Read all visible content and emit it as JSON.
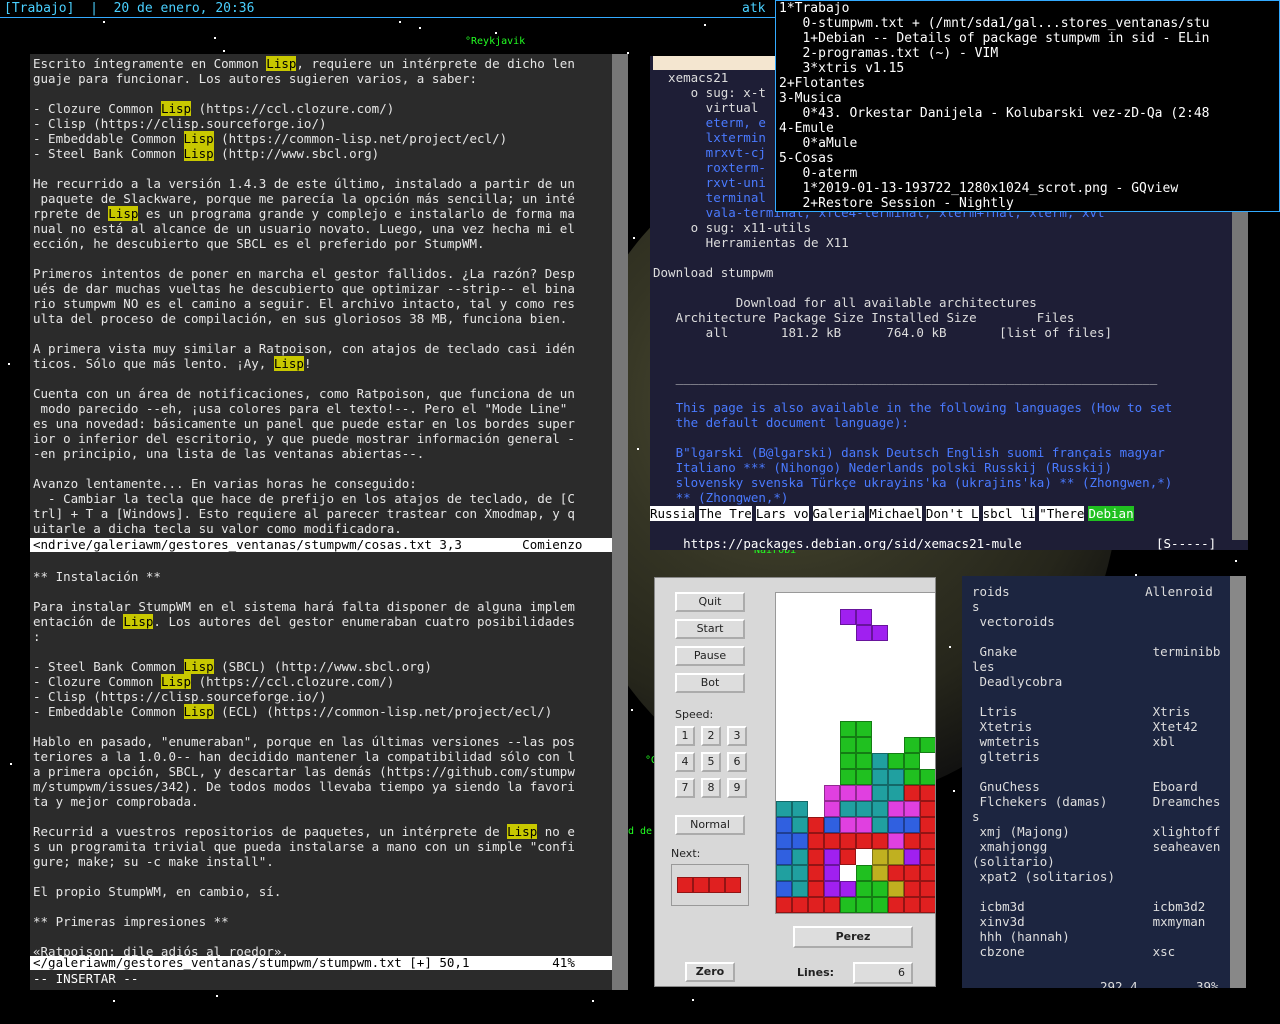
{
  "modeline": {
    "text": "[Trabajo]  |  20 de enero, 20:36",
    "right": "atk"
  },
  "cities": [
    "°Reykjavik",
    "°Nairobi",
    "°G",
    "d de"
  ],
  "menu": {
    "lines": [
      "1*Trabajo",
      "   0-stumpwm.txt + (/mnt/sda1/gal...stores_ventanas/stu",
      "   1+Debian -- Details of package stumpwm in sid - ELin",
      "   2-programas.txt (~) - VIM",
      "   3*xtris v1.15",
      "2+Flotantes",
      "3-Musica",
      "   0*43. Orkestar Danijela - Kolubarski vez-zD-Qa (2:48",
      "4-Emule",
      "   0*aMule",
      "5-Cosas",
      "   0-aterm",
      "   1*2019-01-13-193722_1280x1024_scrot.png - GQview",
      "   2+Restore Session - Nightly"
    ]
  },
  "vim": {
    "top_lines": [
      "Escrito íntegramente en Common |Lisp|, requiere un intérprete de dicho len",
      "guaje para funcionar. Los autores sugieren varios, a saber:",
      "",
      "- Clozure Common |Lisp| (https://ccl.clozure.com/)",
      "- Clisp (https://clisp.sourceforge.io/)",
      "- Embeddable Common |Lisp| (https://common-lisp.net/project/ecl/)",
      "- Steel Bank Common |Lisp| (http://www.sbcl.org)",
      "",
      "He recurrido a la versión 1.4.3 de este último, instalado a partir de un",
      " paquete de Slackware, porque me parecía la opción más sencilla; un inté",
      "rprete de |Lisp| es un programa grande y complejo e instalarlo de forma ma",
      "nual no está al alcance de un usuario novato. Luego, una vez hecha mi el",
      "ección, he descubierto que SBCL es el preferido por StumpWM.",
      "",
      "Primeros intentos de poner en marcha el gestor fallidos. ¿La razón? Desp",
      "ués de dar muchas vueltas he descubierto que optimizar --strip-- el bina",
      "rio stumpwm NO es el camino a seguir. El archivo intacto, tal y como res",
      "ulta del proceso de compilación, en sus gloriosos 38 MB, funciona bien.",
      "",
      "A primera vista muy similar a Ratpoison, con atajos de teclado casi idén",
      "ticos. Sólo que más lento. ¡Ay, |Lisp|!",
      "",
      "Cuenta con un área de notificaciones, como Ratpoison, que funciona de un",
      " modo parecido --eh, ¡usa colores para el texto!--. Pero el \"Mode Line\"",
      "es una novedad: básicamente un panel que puede estar en los bordes super",
      "ior o inferior del escritorio, y que puede mostrar información general -",
      "-en principio, una lista de las ventanas abiertas--.",
      "",
      "Avanzo lentamente... En varias horas he conseguido:",
      "  - Cambiar la tecla que hace de prefijo en los atajos de teclado, de [C",
      "trl] + T a [Windows]. Esto requiere al parecer trastear con Xmodmap, y q",
      "uitarle a dicha tecla su valor como modificadora."
    ],
    "status1": "<ndrive/galeriawm/gestores_ventanas/stumpwm/cosas.txt 3,3        Comienzo",
    "bottom_lines": [
      "",
      "** Instalación **",
      "",
      "Para instalar StumpWM en el sistema hará falta disponer de alguna implem",
      "entación de |Lisp|. Los autores del gestor enumeraban cuatro posibilidades",
      ":",
      "",
      "- Steel Bank Common |Lisp| (SBCL) (http://www.sbcl.org)",
      "- Clozure Common |Lisp| (https://ccl.clozure.com/)",
      "- Clisp (https://clisp.sourceforge.io/)",
      "- Embeddable Common |Lisp| (ECL) (https://common-lisp.net/project/ecl/)",
      "",
      "Hablo en pasado, \"enumeraban\", porque en las últimas versiones --las pos",
      "teriores a la 1.0.0-- han decidido mantener la compatibilidad sólo con l",
      "a primera opción, SBCL, y descartar las demás (https://github.com/stumpw",
      "m/stumpwm/issues/342). De todos modos llevaba tiempo ya siendo la favori",
      "ta y mejor comprobada.",
      "",
      "Recurrid a vuestros repositorios de paquetes, un intérprete de |Lisp| no e",
      "s un programita trivial que pueda instalarse a mano con un simple \"confi",
      "gure; make; su -c make install\".",
      "",
      "El propio StumpWM, en cambio, sí.",
      "",
      "** Primeras impresiones **",
      "",
      "«Ratpoison: dile adiós al roedor»."
    ],
    "status2": "</galeriawm/gestores_ventanas/stumpwm/stumpwm.txt [+] 50,1           41%",
    "mode": "-- INSERTAR --"
  },
  "w3m": {
    "lines": [
      "  xemacs21",
      "     o sug: x-t",
      "       virtual",
      "       eterm, e",
      "       lxtermin",
      "       mrxvt-cj",
      "       roxterm-",
      "       rxvt-uni",
      "       terminal",
      "       vala-terminal, xfce4-terminal, xterm+fnal, xterm, xvt",
      "     o sug: x11-utils",
      "       Herramientas de X11",
      "",
      "Download stumpwm",
      "",
      "           Download for all available architectures",
      "   Architecture Package Size Installed Size        Files",
      "       all       181.2 kB      764.0 kB       [list of files]",
      "",
      "",
      "   ________________________________________________________________",
      "",
      "   This page is also available in the following languages (How to set",
      "   the default document language):",
      "",
      "   B\"lgarski (B@lgarski) dansk Deutsch English suomi français magyar",
      "   Italiano *** (Nihongo) Nederlands polski Russkij (Russkij)",
      "   slovensky svenska Türkçe ukrayins'ka (ukrajins'ka) ** (Zhongwen,*)",
      "   ** (Zhongwen,*)"
    ],
    "tabs": [
      "Russia",
      "The Tre",
      "Lars vo",
      "Galeria",
      "Michael",
      "Don't L",
      "sbcl li",
      "\"There",
      "Debian"
    ],
    "url": "https://packages.debian.org/sid/xemacs21-mule",
    "url_status": "[S-----]"
  },
  "tetris": {
    "buttons": [
      "Quit",
      "Start",
      "Pause",
      "Bot"
    ],
    "speed_label": "Speed:",
    "speeds": [
      "1",
      "2",
      "3",
      "4",
      "5",
      "6",
      "7",
      "8",
      "9"
    ],
    "normal": "Normal",
    "next_label": "Next:",
    "player": "Perez",
    "zero": "Zero",
    "lines_label": "Lines:",
    "lines_value": "6",
    "colors": {
      "purple": "#a020f0",
      "green": "#20c020",
      "teal": "#20a0a0",
      "magenta": "#e040e0",
      "red": "#e02020",
      "yellow": "#c0b020",
      "blue": "#3060e0"
    }
  },
  "gamelist": {
    "lines": [
      "roids                  Allenroid",
      "s",
      " vectoroids",
      "",
      " Gnake                  terminibb",
      "les",
      " Deadlycobra",
      "",
      " Ltris                  Xtris",
      " Xtetris                Xtet42",
      " wmtetris               xbl",
      " gltetris",
      "",
      " GnuChess               Eboard",
      " Flchekers (damas)      Dreamches",
      "s",
      " xmj (Majong)           xlightoff",
      " xmahjongg              seaheaven",
      "(solitario)",
      " xpat2 (solitarios)",
      "",
      " icbm3d                 icbm3d2",
      " xinv3d                 mxmyman",
      " hhh (hannah)",
      " cbzone                 xsc"
    ],
    "position": "292,4",
    "percent": "39%"
  }
}
